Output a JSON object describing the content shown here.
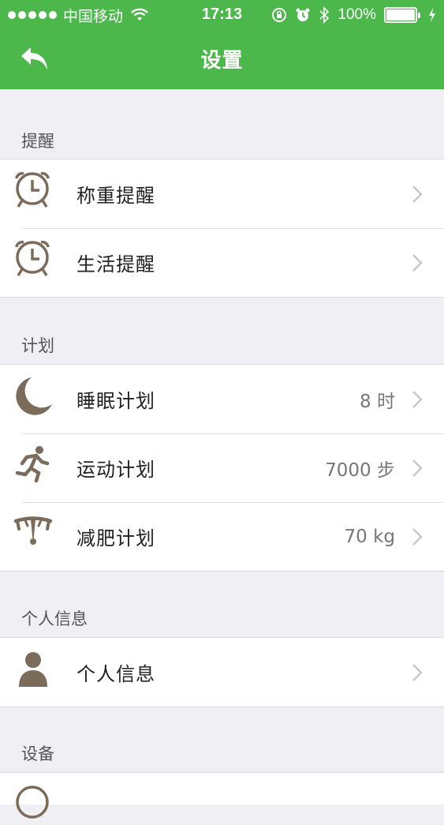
{
  "status_bar": {
    "carrier": "中国移动",
    "time": "17:13",
    "battery_percent": "100%",
    "battery_level": 1.0
  },
  "nav": {
    "title": "设置",
    "back_icon": "back-arrow-icon"
  },
  "sections": [
    {
      "header": "提醒",
      "rows": [
        {
          "icon": "alarm-clock-icon",
          "label": "称重提醒",
          "value": ""
        },
        {
          "icon": "alarm-clock-icon",
          "label": "生活提醒",
          "value": ""
        }
      ]
    },
    {
      "header": "计划",
      "rows": [
        {
          "icon": "moon-icon",
          "label": "睡眠计划",
          "value": "8 时"
        },
        {
          "icon": "running-person-icon",
          "label": "运动计划",
          "value": "7000 步"
        },
        {
          "icon": "scale-icon",
          "label": "减肥计划",
          "value": "70 kg"
        }
      ]
    },
    {
      "header": "个人信息",
      "rows": [
        {
          "icon": "person-icon",
          "label": "个人信息",
          "value": ""
        }
      ]
    },
    {
      "header": "设备",
      "rows": []
    }
  ],
  "colors": {
    "accent_green": "#4cb84c",
    "icon_brown": "#7b6b5a",
    "background": "#efeff4"
  }
}
